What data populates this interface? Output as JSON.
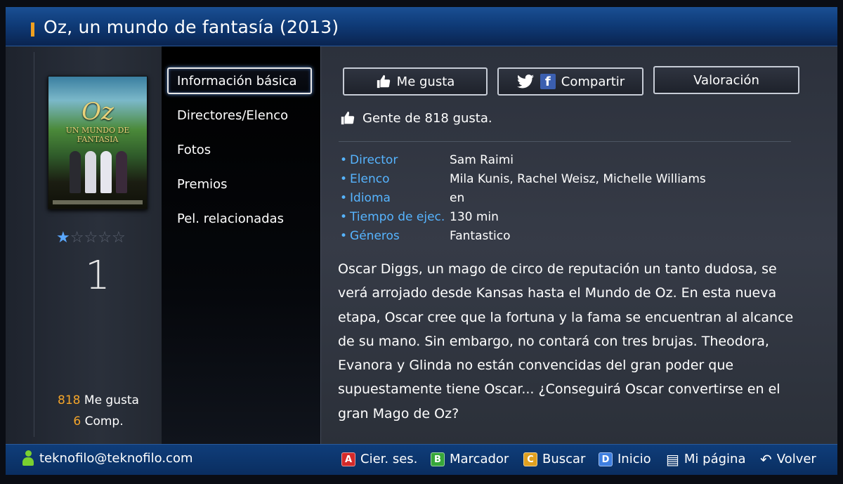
{
  "window": {
    "title": "Oz, un mundo de fantasía (2013)"
  },
  "poster": {
    "title": "Oz",
    "subtitle": "UN MUNDO DE FANTASIA"
  },
  "rating": {
    "stars_filled": 1,
    "stars_total": 5,
    "value": "1"
  },
  "stats": {
    "likes_count": "818",
    "likes_label": "Me gusta",
    "comp_count": "6",
    "comp_label": "Comp."
  },
  "menu": {
    "items": [
      {
        "label": "Información básica",
        "selected": true
      },
      {
        "label": "Directores/Elenco"
      },
      {
        "label": "Fotos"
      },
      {
        "label": "Premios"
      },
      {
        "label": "Pel. relacionadas"
      }
    ]
  },
  "actions": {
    "like_label": "Me gusta",
    "share_label": "Compartir",
    "rate_label": "Valoración"
  },
  "social": {
    "people_like": "Gente de 818 gusta."
  },
  "details": [
    {
      "label": "Director",
      "value": "Sam Raimi"
    },
    {
      "label": "Elenco",
      "value": "Mila Kunis, Rachel Weisz, Michelle Williams"
    },
    {
      "label": "Idioma",
      "value": "en"
    },
    {
      "label": "Tiempo de ejec.",
      "value": "130 min"
    },
    {
      "label": "Géneros",
      "value": "Fantastico"
    }
  ],
  "synopsis": "Oscar Diggs, un mago de circo de reputación un tanto dudosa, se verá arrojado desde Kansas hasta el Mundo de Oz. En esta nueva etapa, Oscar cree que la fortuna y la fama se encuentran al alcance de su mano. Sin embargo, no contará con tres brujas. Theodora, Evanora y Glinda no están convencidas del gran poder que supuestamente tiene Oscar... ¿Conseguirá Oscar convertirse en el gran Mago de Oz?",
  "footer": {
    "user": "teknofilo@teknofilo.com",
    "keys": [
      {
        "key": "A",
        "label": "Cier. ses."
      },
      {
        "key": "B",
        "label": "Marcador"
      },
      {
        "key": "C",
        "label": "Buscar"
      },
      {
        "key": "D",
        "label": "Inicio"
      }
    ],
    "mypage_label": "Mi página",
    "back_label": "Volver"
  },
  "colors": {
    "accent_blue": "#56b4ff",
    "accent_orange": "#f4a52a",
    "title_bar": "#0f3b78",
    "key_a": "#d42a2a",
    "key_b": "#37a73a",
    "key_c": "#e0a020",
    "key_d": "#3f7fe0"
  }
}
